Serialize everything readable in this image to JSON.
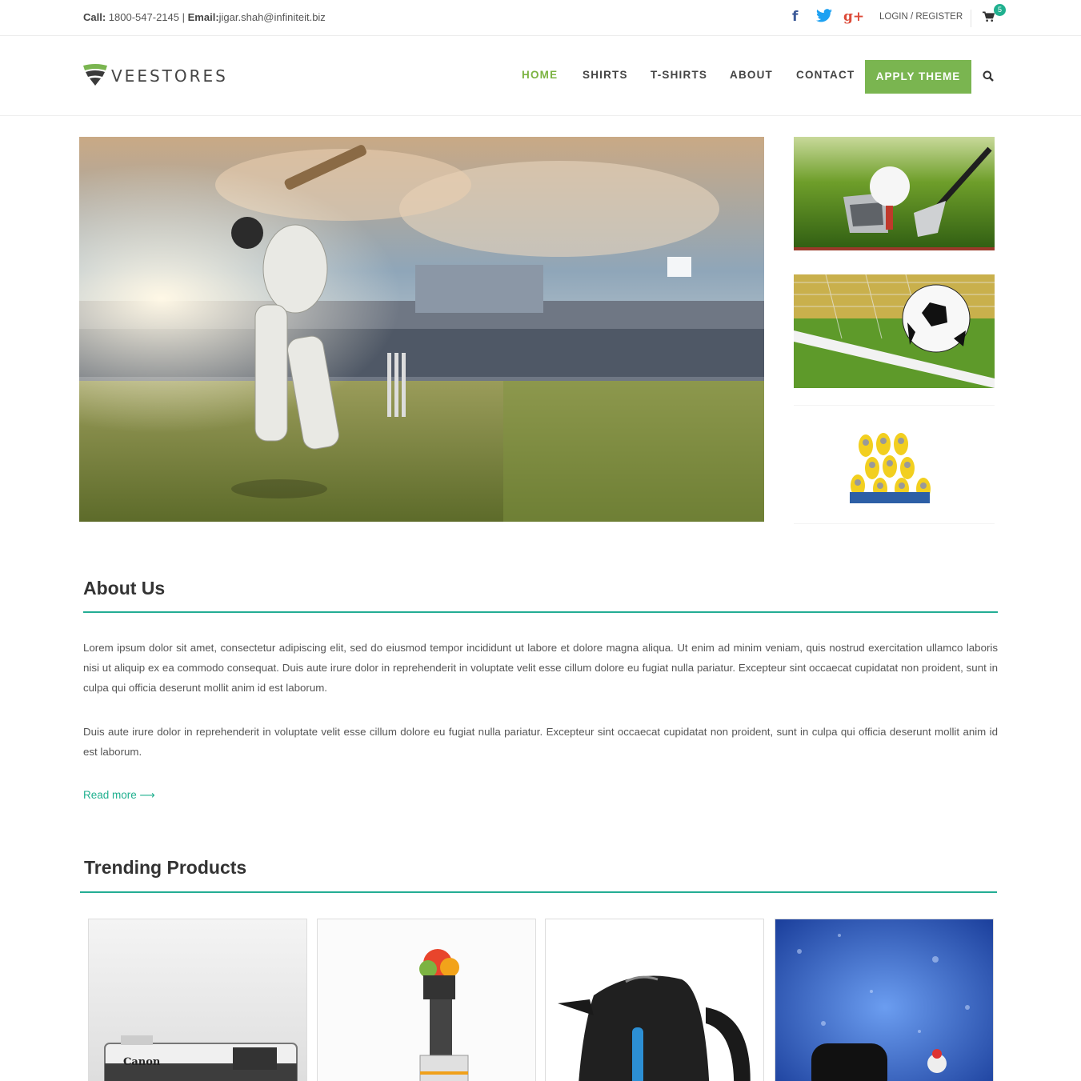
{
  "topbar": {
    "call_label": "Call:",
    "phone": "1800-547-2145",
    "separator": "|",
    "email_label": "Email:",
    "email": "jigar.shah@infiniteit.biz",
    "facebook_glyph": "f",
    "googleplus_glyph": "g+",
    "login_text": "LOGIN / REGISTER",
    "cart_count": "5"
  },
  "header": {
    "logo_text": "VEESTORES",
    "nav": [
      "HOME",
      "SHIRTS",
      "T-SHIRTS",
      "ABOUT",
      "CONTACT"
    ],
    "active_nav": "HOME",
    "cta_label": "APPLY THEME"
  },
  "about": {
    "title": "About Us",
    "paragraph1": "Lorem ipsum dolor sit amet, consectetur adipiscing elit, sed do eiusmod tempor incididunt ut labore et dolore magna aliqua. Ut enim ad minim veniam, quis nostrud exercitation ullamco laboris nisi ut aliquip ex ea commodo consequat. Duis aute irure dolor in reprehenderit in voluptate velit esse cillum dolore eu fugiat nulla pariatur. Excepteur sint occaecat cupidatat non proident, sunt in culpa qui officia deserunt mollit anim id est laborum.",
    "paragraph2": "Duis aute irure dolor in reprehenderit in voluptate velit esse cillum dolore eu fugiat nulla pariatur. Excepteur sint occaecat cupidatat non proident, sunt in culpa qui officia deserunt mollit anim id est laborum.",
    "read_more": "Read more ⟶"
  },
  "trending": {
    "title": "Trending Products",
    "camera_brand": "Canon"
  },
  "colors": {
    "accent_green": "#7ab550",
    "teal": "#23ad94",
    "text": "#333333"
  },
  "icons": [
    "facebook-icon",
    "twitter-icon",
    "googleplus-icon",
    "cart-icon",
    "search-icon",
    "logo-icon"
  ]
}
